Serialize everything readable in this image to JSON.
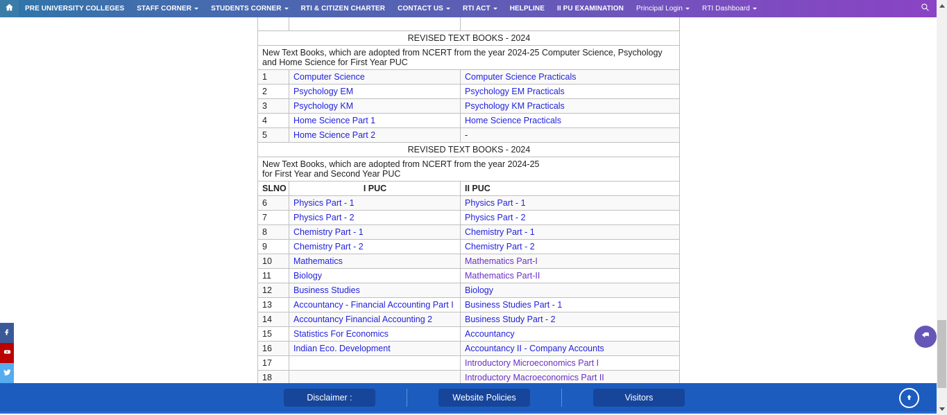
{
  "navbar": {
    "home_icon": "home-icon",
    "search_icon": "search-icon",
    "items": [
      {
        "label": "PRE UNIVERSITY COLLEGES",
        "caret": false
      },
      {
        "label": "STAFF CORNER",
        "caret": true
      },
      {
        "label": "STUDENTS CORNER",
        "caret": true
      },
      {
        "label": "RTI & CITIZEN CHARTER",
        "caret": false
      },
      {
        "label": "CONTACT US",
        "caret": true
      },
      {
        "label": "RTI ACT",
        "caret": true
      },
      {
        "label": "HELPLINE",
        "caret": false
      },
      {
        "label": "II PU EXAMINATION",
        "caret": false
      },
      {
        "label": "Principal Login",
        "caret": true
      },
      {
        "label": "RTI Dashboard",
        "caret": true
      }
    ]
  },
  "table": {
    "section1": {
      "title": "REVISED TEXT BOOKS - 2024",
      "description": "New Text Books, which are adopted from NCERT from the year 2024-25 Computer Science, Psychology and Home Science for First Year PUC",
      "rows": [
        {
          "slno": "1",
          "ipuc": "Computer Science",
          "iipuc": "Computer Science Practicals",
          "ipuc_link": true,
          "iipuc_link": true
        },
        {
          "slno": "2",
          "ipuc": "Psychology EM",
          "iipuc": "Psychology EM Practicals",
          "ipuc_link": true,
          "iipuc_link": true
        },
        {
          "slno": "3",
          "ipuc": "Psychology KM",
          "iipuc": "Psychology KM Practicals",
          "ipuc_link": true,
          "iipuc_link": true
        },
        {
          "slno": "4",
          "ipuc": "Home Science Part 1",
          "iipuc": "Home Science Practicals",
          "ipuc_link": true,
          "iipuc_link": true
        },
        {
          "slno": "5",
          "ipuc": "Home Science Part 2",
          "iipuc": "-",
          "ipuc_link": true,
          "iipuc_link": false
        }
      ]
    },
    "section2": {
      "title": "REVISED TEXT BOOKS - 2024",
      "description": "New Text Books, which are adopted from NCERT from the year 2024-25\nfor First Year and Second Year PUC",
      "headers": {
        "slno": "SLNO",
        "ipuc": "I PUC",
        "iipuc": "II PUC"
      },
      "rows": [
        {
          "slno": "6",
          "ipuc": "Physics Part - 1",
          "iipuc": "Physics Part - 1",
          "ipuc_link": true,
          "iipuc_link": true
        },
        {
          "slno": "7",
          "ipuc": "Physics Part - 2",
          "iipuc": "Physics Part - 2",
          "ipuc_link": true,
          "iipuc_link": true
        },
        {
          "slno": "8",
          "ipuc": "Chemistry Part - 1",
          "iipuc": "Chemistry Part - 1",
          "ipuc_link": true,
          "iipuc_link": true
        },
        {
          "slno": "9",
          "ipuc": "Chemistry Part - 2",
          "iipuc": "Chemistry Part - 2",
          "ipuc_link": true,
          "iipuc_link": true
        },
        {
          "slno": "10",
          "ipuc": "Mathematics",
          "iipuc": "Mathematics Part-I",
          "ipuc_link": true,
          "iipuc_link": true,
          "iipuc_visited": true
        },
        {
          "slno": "11",
          "ipuc": "Biology",
          "iipuc": "Mathematics Part-II",
          "ipuc_link": true,
          "iipuc_link": true,
          "iipuc_visited": true
        },
        {
          "slno": "12",
          "ipuc": "Business Studies",
          "iipuc": "Biology",
          "ipuc_link": true,
          "iipuc_link": true
        },
        {
          "slno": "13",
          "ipuc": "Accountancy - Financial Accounting Part I",
          "iipuc": "Business Studies Part - 1",
          "ipuc_link": true,
          "iipuc_link": true
        },
        {
          "slno": "14",
          "ipuc": "Accountancy Financial Accounting 2",
          "iipuc": "Business Study Part - 2",
          "ipuc_link": true,
          "iipuc_link": true
        },
        {
          "slno": "15",
          "ipuc": "Statistics For Economics",
          "iipuc": "Accountancy",
          "ipuc_link": true,
          "iipuc_link": true
        },
        {
          "slno": "16",
          "ipuc": "Indian Eco. Development",
          "iipuc": "Accountancy II - Company Accounts",
          "ipuc_link": true,
          "iipuc_link": true
        },
        {
          "slno": "17",
          "ipuc": "",
          "iipuc": "Introductory Microeconomics Part I",
          "ipuc_link": false,
          "iipuc_link": true,
          "iipuc_visited": true
        },
        {
          "slno": "18",
          "ipuc": "",
          "iipuc": "Introductory Macroeconomics Part II",
          "ipuc_link": false,
          "iipuc_link": true,
          "iipuc_visited": true
        }
      ]
    }
  },
  "social": [
    {
      "name": "facebook",
      "glyph": "f",
      "color": "#3b5998"
    },
    {
      "name": "youtube",
      "glyph": "yt",
      "color": "#bb0000"
    },
    {
      "name": "twitter",
      "glyph": "tw",
      "color": "#55acee"
    }
  ],
  "footer": {
    "buttons": [
      {
        "label": "Disclaimer :"
      },
      {
        "label": "Website Policies"
      },
      {
        "label": "Visitors"
      }
    ],
    "go_top_icon": "arrow-up-icon"
  },
  "float_back": {
    "icon": "back-arrow-icon"
  },
  "colors": {
    "nav_start": "#2d76a8",
    "nav_end": "#8a44c4",
    "link": "#2222dd",
    "visited_link": "#6a2fc4",
    "section_title": "#ff2d16",
    "header_red": "#ff1100",
    "footer_bar": "#1c5cbf",
    "footer_button": "#17459a",
    "float_back": "#6656b8"
  }
}
